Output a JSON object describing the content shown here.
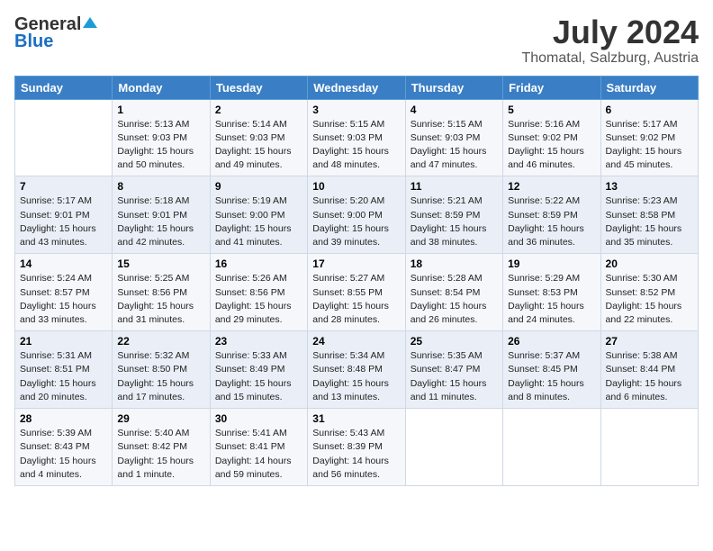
{
  "header": {
    "logo_line1": "General",
    "logo_line2": "Blue",
    "main_title": "July 2024",
    "subtitle": "Thomatal, Salzburg, Austria"
  },
  "calendar": {
    "days_of_week": [
      "Sunday",
      "Monday",
      "Tuesday",
      "Wednesday",
      "Thursday",
      "Friday",
      "Saturday"
    ],
    "weeks": [
      [
        {
          "day": "",
          "info": ""
        },
        {
          "day": "1",
          "info": "Sunrise: 5:13 AM\nSunset: 9:03 PM\nDaylight: 15 hours\nand 50 minutes."
        },
        {
          "day": "2",
          "info": "Sunrise: 5:14 AM\nSunset: 9:03 PM\nDaylight: 15 hours\nand 49 minutes."
        },
        {
          "day": "3",
          "info": "Sunrise: 5:15 AM\nSunset: 9:03 PM\nDaylight: 15 hours\nand 48 minutes."
        },
        {
          "day": "4",
          "info": "Sunrise: 5:15 AM\nSunset: 9:03 PM\nDaylight: 15 hours\nand 47 minutes."
        },
        {
          "day": "5",
          "info": "Sunrise: 5:16 AM\nSunset: 9:02 PM\nDaylight: 15 hours\nand 46 minutes."
        },
        {
          "day": "6",
          "info": "Sunrise: 5:17 AM\nSunset: 9:02 PM\nDaylight: 15 hours\nand 45 minutes."
        }
      ],
      [
        {
          "day": "7",
          "info": "Sunrise: 5:17 AM\nSunset: 9:01 PM\nDaylight: 15 hours\nand 43 minutes."
        },
        {
          "day": "8",
          "info": "Sunrise: 5:18 AM\nSunset: 9:01 PM\nDaylight: 15 hours\nand 42 minutes."
        },
        {
          "day": "9",
          "info": "Sunrise: 5:19 AM\nSunset: 9:00 PM\nDaylight: 15 hours\nand 41 minutes."
        },
        {
          "day": "10",
          "info": "Sunrise: 5:20 AM\nSunset: 9:00 PM\nDaylight: 15 hours\nand 39 minutes."
        },
        {
          "day": "11",
          "info": "Sunrise: 5:21 AM\nSunset: 8:59 PM\nDaylight: 15 hours\nand 38 minutes."
        },
        {
          "day": "12",
          "info": "Sunrise: 5:22 AM\nSunset: 8:59 PM\nDaylight: 15 hours\nand 36 minutes."
        },
        {
          "day": "13",
          "info": "Sunrise: 5:23 AM\nSunset: 8:58 PM\nDaylight: 15 hours\nand 35 minutes."
        }
      ],
      [
        {
          "day": "14",
          "info": "Sunrise: 5:24 AM\nSunset: 8:57 PM\nDaylight: 15 hours\nand 33 minutes."
        },
        {
          "day": "15",
          "info": "Sunrise: 5:25 AM\nSunset: 8:56 PM\nDaylight: 15 hours\nand 31 minutes."
        },
        {
          "day": "16",
          "info": "Sunrise: 5:26 AM\nSunset: 8:56 PM\nDaylight: 15 hours\nand 29 minutes."
        },
        {
          "day": "17",
          "info": "Sunrise: 5:27 AM\nSunset: 8:55 PM\nDaylight: 15 hours\nand 28 minutes."
        },
        {
          "day": "18",
          "info": "Sunrise: 5:28 AM\nSunset: 8:54 PM\nDaylight: 15 hours\nand 26 minutes."
        },
        {
          "day": "19",
          "info": "Sunrise: 5:29 AM\nSunset: 8:53 PM\nDaylight: 15 hours\nand 24 minutes."
        },
        {
          "day": "20",
          "info": "Sunrise: 5:30 AM\nSunset: 8:52 PM\nDaylight: 15 hours\nand 22 minutes."
        }
      ],
      [
        {
          "day": "21",
          "info": "Sunrise: 5:31 AM\nSunset: 8:51 PM\nDaylight: 15 hours\nand 20 minutes."
        },
        {
          "day": "22",
          "info": "Sunrise: 5:32 AM\nSunset: 8:50 PM\nDaylight: 15 hours\nand 17 minutes."
        },
        {
          "day": "23",
          "info": "Sunrise: 5:33 AM\nSunset: 8:49 PM\nDaylight: 15 hours\nand 15 minutes."
        },
        {
          "day": "24",
          "info": "Sunrise: 5:34 AM\nSunset: 8:48 PM\nDaylight: 15 hours\nand 13 minutes."
        },
        {
          "day": "25",
          "info": "Sunrise: 5:35 AM\nSunset: 8:47 PM\nDaylight: 15 hours\nand 11 minutes."
        },
        {
          "day": "26",
          "info": "Sunrise: 5:37 AM\nSunset: 8:45 PM\nDaylight: 15 hours\nand 8 minutes."
        },
        {
          "day": "27",
          "info": "Sunrise: 5:38 AM\nSunset: 8:44 PM\nDaylight: 15 hours\nand 6 minutes."
        }
      ],
      [
        {
          "day": "28",
          "info": "Sunrise: 5:39 AM\nSunset: 8:43 PM\nDaylight: 15 hours\nand 4 minutes."
        },
        {
          "day": "29",
          "info": "Sunrise: 5:40 AM\nSunset: 8:42 PM\nDaylight: 15 hours\nand 1 minute."
        },
        {
          "day": "30",
          "info": "Sunrise: 5:41 AM\nSunset: 8:41 PM\nDaylight: 14 hours\nand 59 minutes."
        },
        {
          "day": "31",
          "info": "Sunrise: 5:43 AM\nSunset: 8:39 PM\nDaylight: 14 hours\nand 56 minutes."
        },
        {
          "day": "",
          "info": ""
        },
        {
          "day": "",
          "info": ""
        },
        {
          "day": "",
          "info": ""
        }
      ]
    ]
  }
}
